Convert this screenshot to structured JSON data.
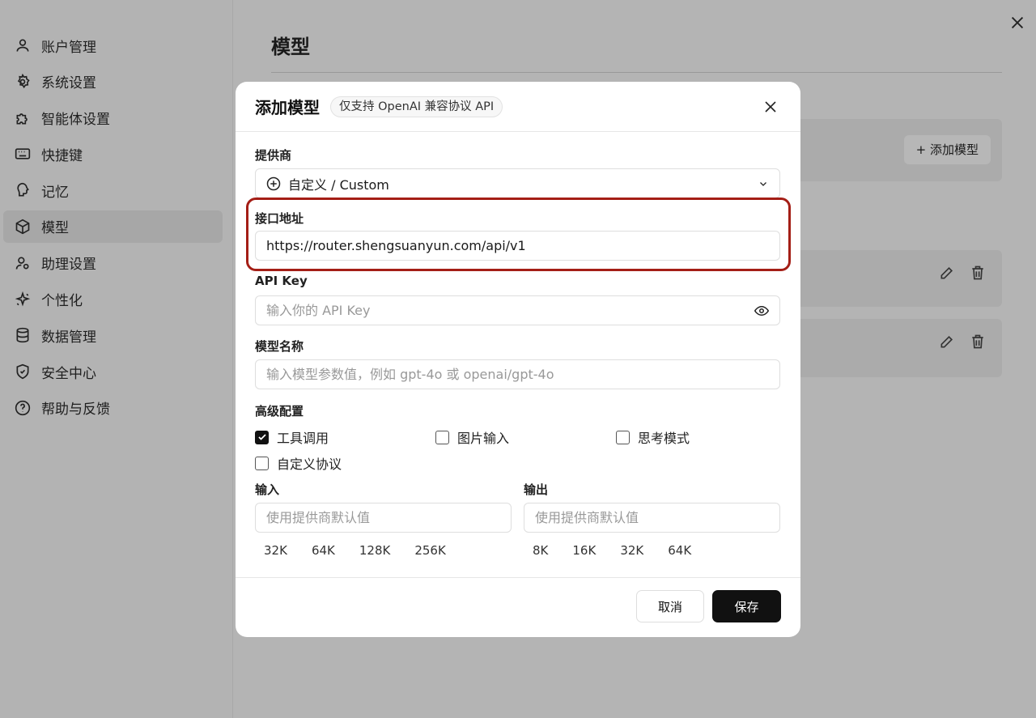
{
  "sidebar": {
    "items": [
      {
        "label": "账户管理",
        "icon": "user-icon"
      },
      {
        "label": "系统设置",
        "icon": "gear-icon"
      },
      {
        "label": "智能体设置",
        "icon": "puzzle-icon"
      },
      {
        "label": "快捷键",
        "icon": "keyboard-icon"
      },
      {
        "label": "记忆",
        "icon": "brain-icon"
      },
      {
        "label": "模型",
        "icon": "cube-icon",
        "active": true
      },
      {
        "label": "助理设置",
        "icon": "user-gear-icon"
      },
      {
        "label": "个性化",
        "icon": "sparkle-icon"
      },
      {
        "label": "数据管理",
        "icon": "database-icon"
      },
      {
        "label": "安全中心",
        "icon": "shield-icon"
      },
      {
        "label": "帮助与反馈",
        "icon": "help-icon"
      }
    ]
  },
  "main": {
    "title": "模型",
    "add_model_label": "+ 添加模型"
  },
  "modal": {
    "title": "添加模型",
    "tag": "仅支持 OpenAI 兼容协议 API",
    "provider": {
      "label": "提供商",
      "value": "自定义 / Custom"
    },
    "endpoint": {
      "label": "接口地址",
      "value": "https://router.shengsuanyun.com/api/v1"
    },
    "api_key": {
      "label": "API Key",
      "placeholder": "输入你的 API Key"
    },
    "model_name": {
      "label": "模型名称",
      "placeholder": "输入模型参数值，例如 gpt-4o 或 openai/gpt-4o"
    },
    "advanced": {
      "label": "高级配置",
      "options": [
        {
          "label": "工具调用",
          "checked": true
        },
        {
          "label": "图片输入",
          "checked": false
        },
        {
          "label": "思考模式",
          "checked": false
        },
        {
          "label": "自定义协议",
          "checked": false
        }
      ]
    },
    "input_tokens": {
      "label": "输入",
      "placeholder": "使用提供商默认值",
      "chips": [
        "32K",
        "64K",
        "128K",
        "256K"
      ]
    },
    "output_tokens": {
      "label": "输出",
      "placeholder": "使用提供商默认值",
      "chips": [
        "8K",
        "16K",
        "32K",
        "64K"
      ]
    },
    "cancel_label": "取消",
    "save_label": "保存"
  },
  "colors": {
    "highlight": "#a41e16",
    "primary_button": "#111111"
  }
}
